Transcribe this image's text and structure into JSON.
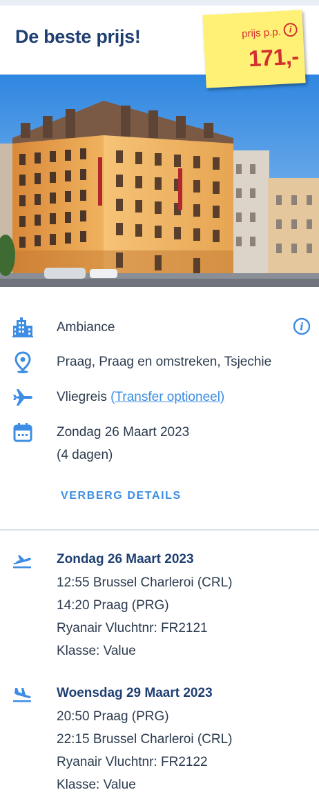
{
  "header": {
    "title": "De beste prijs!",
    "price_label": "prijs p.p.",
    "price_info": "i",
    "price_value": "171,-"
  },
  "hotel": {
    "name": "Ambiance",
    "location": "Praag, Praag en omstreken, Tsjechie",
    "travel_type": "Vliegreis",
    "transfer_link": "(Transfer optioneel)",
    "date": "Zondag 26 Maart 2023",
    "duration": "(4 dagen)",
    "info_label": "i"
  },
  "details_toggle": "VERBERG DETAILS",
  "flights": [
    {
      "date": "Zondag 26 Maart 2023",
      "departure": "12:55 Brussel Charleroi (CRL)",
      "arrival": "14:20 Praag (PRG)",
      "flight": "Ryanair Vluchtnr: FR2121",
      "class": "Klasse: Value"
    },
    {
      "date": "Woensdag 29 Maart 2023",
      "departure": "20:50 Praag (PRG)",
      "arrival": "22:15 Brussel Charleroi (CRL)",
      "flight": "Ryanair Vluchtnr: FR2122",
      "class": "Klasse: Value"
    }
  ],
  "colors": {
    "accent": "#3c8de3",
    "title": "#1f3f72",
    "price": "#d32f2f",
    "price_tag": "#fff176",
    "building": "#e8a04a"
  },
  "icons": {
    "hotel": "building-icon",
    "location": "map-pin-icon",
    "travel": "airplane-icon",
    "date": "calendar-icon",
    "info": "info-icon",
    "outbound": "plane-departure-icon",
    "return": "plane-arrival-icon"
  }
}
